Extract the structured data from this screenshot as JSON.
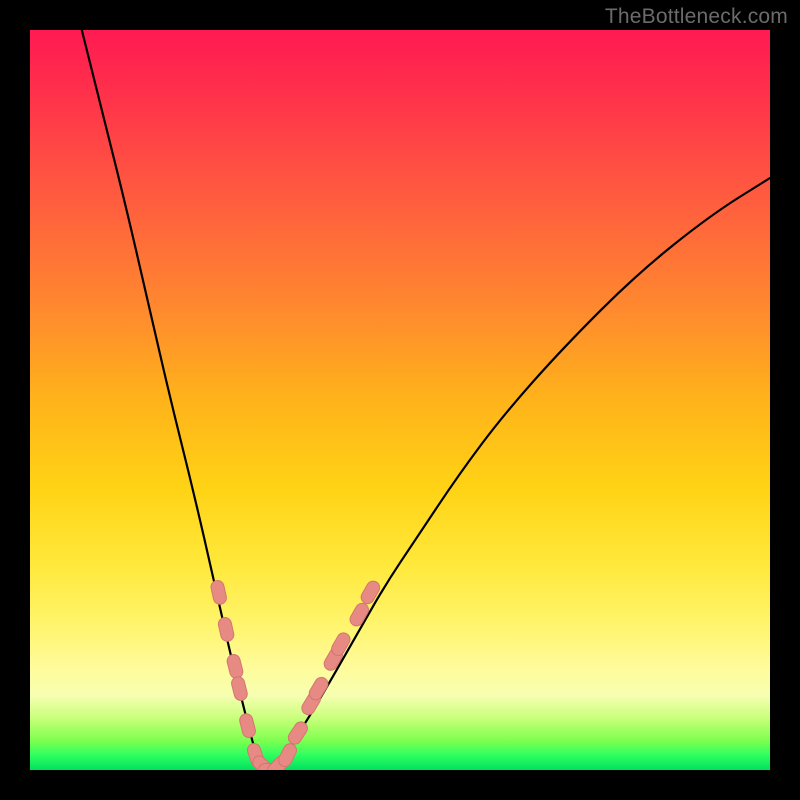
{
  "watermark": "TheBottleneck.com",
  "colors": {
    "marker_fill": "#e88a84",
    "marker_stroke": "#d27670",
    "curve": "#000000"
  },
  "chart_data": {
    "type": "line",
    "title": "",
    "xlabel": "",
    "ylabel": "",
    "xlim": [
      0,
      100
    ],
    "ylim": [
      0,
      100
    ],
    "grid": false,
    "legend": null,
    "series": [
      {
        "name": "bottleneck-curve",
        "note": "V-shaped curve; minimum (0% bottleneck) near x≈32. Values are percent bottleneck read from the vertical gradient (0 at bottom, 100 at top).",
        "x": [
          7,
          10,
          13,
          16,
          19,
          22,
          25,
          27,
          29,
          30,
          31,
          32,
          33,
          34,
          35,
          37,
          40,
          44,
          48,
          52,
          58,
          64,
          72,
          82,
          92,
          100
        ],
        "values": [
          100,
          88,
          76,
          63,
          50,
          38,
          25,
          16,
          8,
          4,
          1,
          0,
          0,
          1,
          3,
          6,
          11,
          18,
          25,
          31,
          40,
          48,
          57,
          67,
          75,
          80
        ]
      }
    ],
    "markers": {
      "name": "highlight-points",
      "note": "Salmon lozenge markers clustered around the valley on both branches.",
      "points": [
        {
          "x": 25.5,
          "y": 24
        },
        {
          "x": 26.5,
          "y": 19
        },
        {
          "x": 27.7,
          "y": 14
        },
        {
          "x": 28.3,
          "y": 11
        },
        {
          "x": 29.4,
          "y": 6
        },
        {
          "x": 30.5,
          "y": 2
        },
        {
          "x": 31.5,
          "y": 0.5
        },
        {
          "x": 32.5,
          "y": 0
        },
        {
          "x": 33.5,
          "y": 0.5
        },
        {
          "x": 34.8,
          "y": 2
        },
        {
          "x": 36.2,
          "y": 5
        },
        {
          "x": 38.0,
          "y": 9
        },
        {
          "x": 39.0,
          "y": 11
        },
        {
          "x": 41.0,
          "y": 15
        },
        {
          "x": 42.0,
          "y": 17
        },
        {
          "x": 44.5,
          "y": 21
        },
        {
          "x": 46.0,
          "y": 24
        }
      ]
    }
  }
}
